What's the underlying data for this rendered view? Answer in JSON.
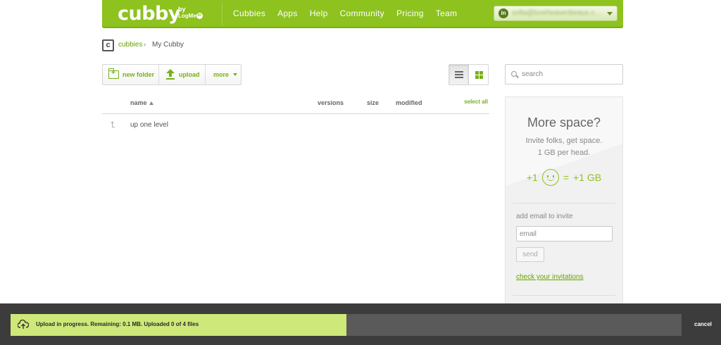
{
  "header": {
    "logo": "cubby",
    "logo_by": "by",
    "logo_brand": "LogMe",
    "logo_brand_in": "in",
    "nav": [
      "Cubbies",
      "Apps",
      "Help",
      "Community",
      "Pricing",
      "Team"
    ],
    "user_icon_text": "in",
    "user_email": "sofia@loveheavenbeaux.c..."
  },
  "breadcrumb": {
    "badge": "c",
    "link": "cubbies",
    "separator": "›",
    "current": "My Cubby"
  },
  "toolbar": {
    "new_folder": "new folder",
    "upload": "upload",
    "more": "more"
  },
  "search": {
    "placeholder": "search"
  },
  "file_list": {
    "columns": {
      "name": "name",
      "versions": "versions",
      "size": "size",
      "modified": "modified",
      "select_all": "select all"
    },
    "rows": [
      {
        "label": "up one level",
        "icon": "up-arrow-icon"
      }
    ]
  },
  "promo": {
    "title": "More space?",
    "line1": "Invite folks, get space.",
    "line2": "1 GB per head.",
    "plus_one": "+1",
    "equals": "=",
    "gb": "+1 GB",
    "invite_label": "add email to invite",
    "email_placeholder": "email",
    "send": "send",
    "check": "check your invitations"
  },
  "upload": {
    "message": "Upload in progress. Remaining: 0.1 MB. Uploaded 0 of 4 files",
    "progress_fraction": 0.5,
    "cancel": "cancel"
  },
  "colors": {
    "brand_green": "#8dc21f",
    "link_green": "#6aa100",
    "progress_fill": "#cfe87a",
    "upload_bar_bg": "#3c3c3c"
  }
}
